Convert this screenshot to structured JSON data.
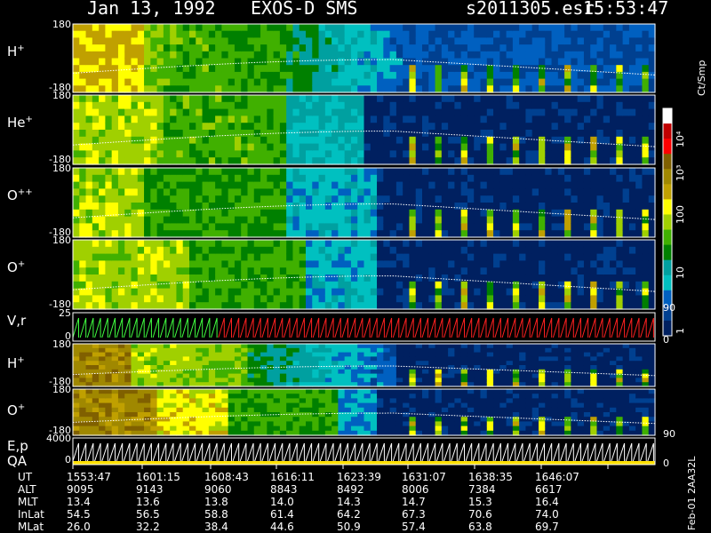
{
  "header": {
    "date": "Jan 13, 1992",
    "instrument": "EXOS-D SMS",
    "file": "s2011305.esr",
    "time": "15:53:47"
  },
  "colorbar": {
    "unit": "Ct/Smp",
    "ticks": [
      "10⁴",
      "10³",
      "100",
      "10",
      "1"
    ],
    "colors": [
      "#ffffff",
      "#c00000",
      "#ff0000",
      "#806000",
      "#a08800",
      "#c0a000",
      "#ffff00",
      "#a0d000",
      "#40b000",
      "#008000",
      "#00a0a0",
      "#00c0c0",
      "#0060c0",
      "#004090",
      "#002060"
    ]
  },
  "panels": [
    {
      "label": "H",
      "sup": "+",
      "ytop": "180",
      "ybot": "-180"
    },
    {
      "label": "He",
      "sup": "+",
      "ytop": "180",
      "ybot": "-180"
    },
    {
      "label": "O",
      "sup": "++",
      "ytop": "180",
      "ybot": "-180"
    },
    {
      "label": "O",
      "sup": "+",
      "ytop": "180",
      "ybot": "-180",
      "right": "90"
    },
    {
      "label": "V,r",
      "sup": "",
      "ytop": "25",
      "ybot": "0",
      "right": "0"
    },
    {
      "label": "H",
      "sup": "+",
      "ytop": "180",
      "ybot": "-180"
    },
    {
      "label": "O",
      "sup": "+",
      "ytop": "180",
      "ybot": "-180",
      "right": "90"
    },
    {
      "label": "E,p",
      "sup": "",
      "ytop": "4000",
      "ybot": "0",
      "right": "0"
    }
  ],
  "qa_label": "QA",
  "table": {
    "rows": [
      {
        "name": "UT",
        "values": [
          "1553:47",
          "1601:15",
          "1608:43",
          "1616:11",
          "1623:39",
          "1631:07",
          "1638:35",
          "1646:07"
        ]
      },
      {
        "name": "ALT",
        "values": [
          "9095",
          "9143",
          "9060",
          "8843",
          "8492",
          "8006",
          "7384",
          "6617"
        ]
      },
      {
        "name": "MLT",
        "values": [
          "13.4",
          "13.6",
          "13.8",
          "14.0",
          "14.3",
          "14.7",
          "15.3",
          "16.4"
        ]
      },
      {
        "name": "InLat",
        "values": [
          "54.5",
          "56.5",
          "58.8",
          "61.4",
          "64.2",
          "67.3",
          "70.6",
          "74.0"
        ]
      },
      {
        "name": "MLat",
        "values": [
          "26.0",
          "32.2",
          "38.4",
          "44.6",
          "50.9",
          "57.4",
          "63.8",
          "69.7"
        ]
      }
    ]
  },
  "footer_id": "Feb-01 2AA32L"
}
